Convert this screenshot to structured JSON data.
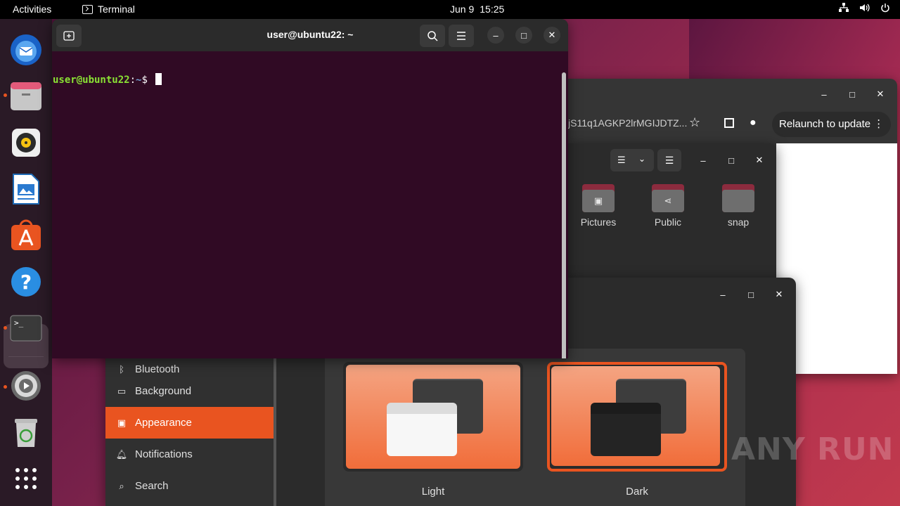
{
  "topbar": {
    "activities": "Activities",
    "app_name": "Terminal",
    "date": "Jun 9",
    "time": "15:25"
  },
  "dock": {
    "items": [
      "thunderbird-icon",
      "files-icon",
      "rhythmbox-icon",
      "libreoffice-writer-icon",
      "app-center-icon",
      "help-icon",
      "terminal-icon",
      "settings-icon",
      "trash-icon",
      "show-apps-icon"
    ]
  },
  "terminal": {
    "title": "user@ubuntu22: ~",
    "prompt_user": "user@ubuntu22",
    "prompt_sep": ":",
    "prompt_path": "~",
    "prompt_symbol": "$"
  },
  "chrome": {
    "url_fragment": "jS11q1AGKP2lrMGIJDTZ...",
    "relaunch_label": "Relaunch to update"
  },
  "files": {
    "folders": [
      {
        "label": "Pictures",
        "icon": "pictures-icon"
      },
      {
        "label": "Public",
        "icon": "share-icon"
      },
      {
        "label": "snap",
        "icon": "folder-icon"
      }
    ]
  },
  "settings": {
    "sidebar": [
      {
        "label": "Bluetooth",
        "icon": "bluetooth-icon"
      },
      {
        "label": "Background",
        "icon": "background-icon"
      },
      {
        "label": "Appearance",
        "icon": "appearance-icon",
        "active": true
      },
      {
        "label": "Notifications",
        "icon": "bell-icon"
      },
      {
        "label": "Search",
        "icon": "search-icon"
      }
    ],
    "themes": [
      {
        "label": "Light",
        "selected": false
      },
      {
        "label": "Dark",
        "selected": true
      }
    ]
  },
  "watermark": "ANY RUN",
  "colors": {
    "accent": "#e95420",
    "terminal_bg": "#300a24",
    "prompt_green": "#8ae234",
    "prompt_blue": "#729fcf"
  }
}
